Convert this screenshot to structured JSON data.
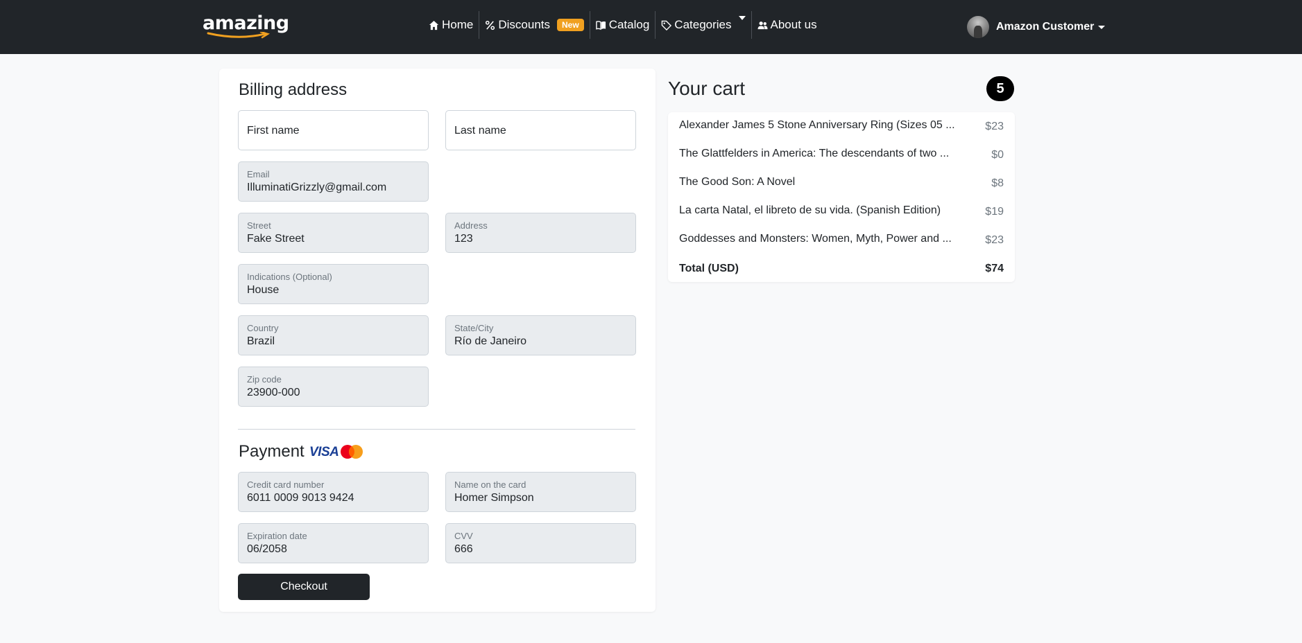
{
  "navbar": {
    "brand": "amazing",
    "items": [
      {
        "label": "Home",
        "icon": "home-icon"
      },
      {
        "label": "Discounts",
        "icon": "percent-icon",
        "badge": "New"
      },
      {
        "label": "Catalog",
        "icon": "book-icon"
      },
      {
        "label": "Categories",
        "icon": "tag-icon"
      },
      {
        "label": "About us",
        "icon": "users-icon"
      }
    ],
    "user": "Amazon Customer"
  },
  "billing": {
    "title": "Billing address",
    "first_name": {
      "placeholder": "First name"
    },
    "last_name": {
      "placeholder": "Last name"
    },
    "email": {
      "label": "Email",
      "value": "IlluminatiGrizzly@gmail.com"
    },
    "street": {
      "label": "Street",
      "value": "Fake Street"
    },
    "address": {
      "label": "Address",
      "value": "123"
    },
    "indications": {
      "label": "Indications (Optional)",
      "value": "House"
    },
    "country": {
      "label": "Country",
      "value": "Brazil"
    },
    "state_city": {
      "label": "State/City",
      "value": "Río de Janeiro"
    },
    "zip": {
      "label": "Zip code",
      "value": "23900-000"
    }
  },
  "payment": {
    "title": "Payment",
    "visa": "VISA",
    "mastercard": "MasterCard",
    "card_number": {
      "label": "Credit card number",
      "value": "6011 0009 9013 9424"
    },
    "card_name": {
      "label": "Name on the card",
      "value": "Homer Simpson"
    },
    "expiration": {
      "label": "Expiration date",
      "value": "06/2058"
    },
    "cvv": {
      "label": "CVV",
      "value": "666"
    },
    "checkout_label": "Checkout"
  },
  "cart": {
    "title": "Your cart",
    "count": "5",
    "items": [
      {
        "name": "Alexander James 5 Stone Anniversary Ring (Sizes 05 ...",
        "price": "$23"
      },
      {
        "name": "The Glattfelders in America: The descendants of two ...",
        "price": "$0"
      },
      {
        "name": "The Good Son: A Novel",
        "price": "$8"
      },
      {
        "name": "La carta Natal, el libreto de su vida. (Spanish Edition)",
        "price": "$19"
      },
      {
        "name": "Goddesses and Monsters: Women, Myth, Power and ...",
        "price": "$23"
      }
    ],
    "total_label": "Total (USD)",
    "total_value": "$74"
  },
  "colors": {
    "navbar": "#212529",
    "badge": "#f0a020",
    "page_bg": "#f8f9fa",
    "readonly_field": "#e9ecef"
  }
}
